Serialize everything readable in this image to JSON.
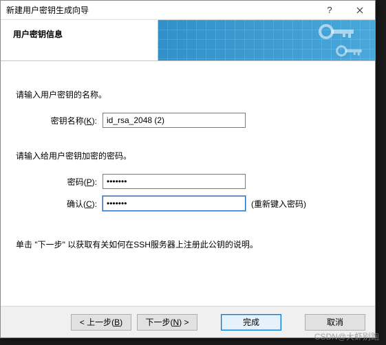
{
  "window": {
    "title": "新建用户密钥生成向导"
  },
  "banner": {
    "title": "用户密钥信息"
  },
  "form": {
    "name_prompt": "请输入用户密钥的名称。",
    "name_label_pre": "密钥名称(",
    "name_label_key": "K",
    "name_label_post": "):",
    "name_value": "id_rsa_2048 (2)",
    "pass_prompt": "请输入给用户密钥加密的密码。",
    "pass_label_pre": "密码(",
    "pass_label_key": "P",
    "pass_label_post": "):",
    "pass_value": "•••••••",
    "confirm_label_pre": "确认(",
    "confirm_label_key": "C",
    "confirm_label_post": "):",
    "confirm_value": "•••••••",
    "confirm_hint": "(重新键入密码)",
    "instruction": "单击 \"下一步\" 以获取有关如何在SSH服务器上注册此公钥的说明。"
  },
  "buttons": {
    "back_pre": "< 上一步(",
    "back_key": "B",
    "back_post": ")",
    "next_pre": "下一步(",
    "next_key": "N",
    "next_post": ") >",
    "finish": "完成",
    "cancel": "取消"
  },
  "watermark": "CSDN@大虾别跑"
}
